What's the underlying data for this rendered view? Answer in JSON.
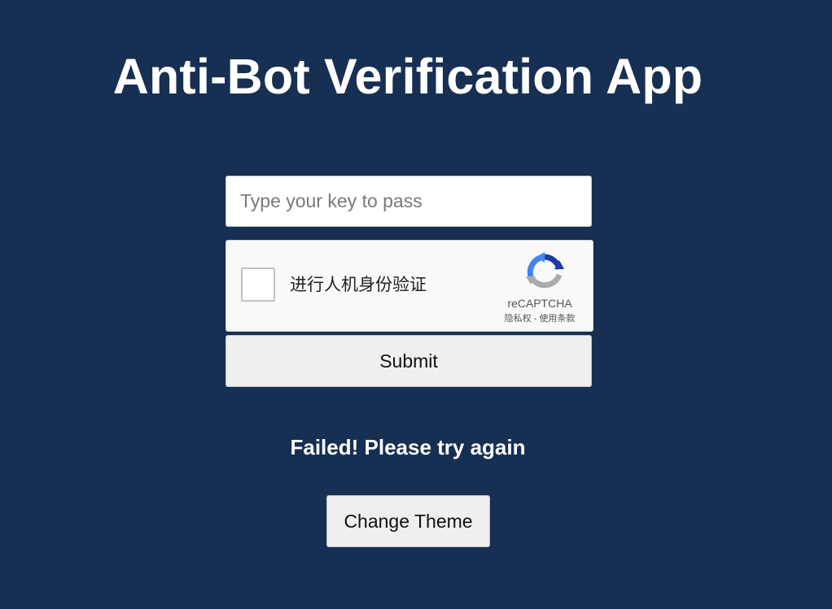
{
  "app": {
    "title": "Anti-Bot Verification App"
  },
  "form": {
    "key_input": {
      "value": "",
      "placeholder": "Type your key to pass"
    },
    "recaptcha": {
      "checkbox_label": "进行人机身份验证",
      "brand": "reCAPTCHA",
      "privacy_link": "隐私权",
      "separator": " - ",
      "terms_link": "使用条款",
      "icon": "recaptcha-logo-icon",
      "checked": false
    },
    "submit_label": "Submit"
  },
  "status": {
    "message": "Failed! Please try again"
  },
  "theme": {
    "change_label": "Change Theme",
    "background_color": "#172f52",
    "text_color": "#ffffff",
    "button_color": "#efefef"
  }
}
